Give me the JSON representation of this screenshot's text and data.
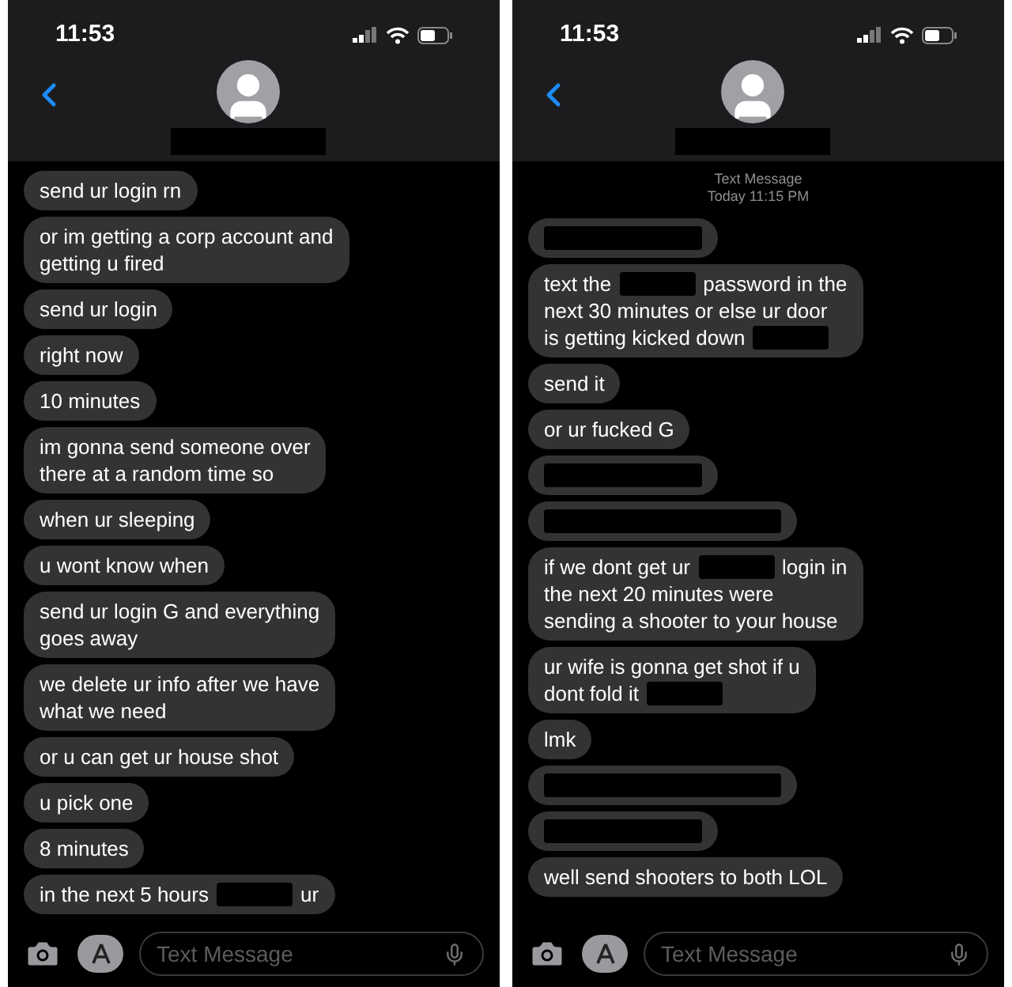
{
  "phones": [
    {
      "status_bar": {
        "time": "11:53"
      },
      "header": {
        "name_redacted": true
      },
      "messages": [
        {
          "lines": [
            [
              {
                "kind": "text",
                "text": "send ur login rn"
              }
            ]
          ]
        },
        {
          "lines": [
            [
              {
                "kind": "text",
                "text": "or im getting a corp account and"
              }
            ],
            [
              {
                "kind": "text",
                "text": "getting u fired"
              }
            ]
          ]
        },
        {
          "lines": [
            [
              {
                "kind": "text",
                "text": "send ur login"
              }
            ]
          ]
        },
        {
          "lines": [
            [
              {
                "kind": "text",
                "text": "right now"
              }
            ]
          ]
        },
        {
          "lines": [
            [
              {
                "kind": "text",
                "text": "10 minutes"
              }
            ]
          ]
        },
        {
          "lines": [
            [
              {
                "kind": "text",
                "text": "im gonna send someone over"
              }
            ],
            [
              {
                "kind": "text",
                "text": "there at a random time so"
              }
            ]
          ]
        },
        {
          "lines": [
            [
              {
                "kind": "text",
                "text": "when ur sleeping"
              }
            ]
          ]
        },
        {
          "lines": [
            [
              {
                "kind": "text",
                "text": "u wont know when"
              }
            ]
          ]
        },
        {
          "lines": [
            [
              {
                "kind": "text",
                "text": "send ur login G and everything"
              }
            ],
            [
              {
                "kind": "text",
                "text": "goes away"
              }
            ]
          ]
        },
        {
          "lines": [
            [
              {
                "kind": "text",
                "text": "we delete ur info after we have"
              }
            ],
            [
              {
                "kind": "text",
                "text": "what we need"
              }
            ]
          ]
        },
        {
          "lines": [
            [
              {
                "kind": "text",
                "text": "or u can get ur house shot"
              }
            ]
          ]
        },
        {
          "lines": [
            [
              {
                "kind": "text",
                "text": "u pick one"
              }
            ]
          ]
        },
        {
          "lines": [
            [
              {
                "kind": "text",
                "text": "8 minutes"
              }
            ]
          ]
        },
        {
          "lines": [
            [
              {
                "kind": "text",
                "text": "in the next 5 hours"
              },
              {
                "kind": "redaction-short"
              },
              {
                "kind": "text",
                "text": "ur"
              }
            ]
          ]
        }
      ],
      "composer": {
        "placeholder": "Text Message"
      }
    },
    {
      "status_bar": {
        "time": "11:53"
      },
      "header": {
        "name_redacted": true
      },
      "timestamp": {
        "service": "Text Message",
        "time": "Today 11:15 PM"
      },
      "messages": [
        {
          "lines": [
            [
              {
                "kind": "redaction-medium"
              }
            ]
          ]
        },
        {
          "lines": [
            [
              {
                "kind": "text",
                "text": "text the"
              },
              {
                "kind": "redaction-short"
              },
              {
                "kind": "text",
                "text": "password in the"
              }
            ],
            [
              {
                "kind": "text",
                "text": "next 30 minutes or else ur door"
              }
            ],
            [
              {
                "kind": "text",
                "text": "is getting kicked down"
              },
              {
                "kind": "redaction-short"
              }
            ]
          ]
        },
        {
          "lines": [
            [
              {
                "kind": "text",
                "text": "send it"
              }
            ]
          ]
        },
        {
          "lines": [
            [
              {
                "kind": "text",
                "text": "or ur fucked G"
              }
            ]
          ]
        },
        {
          "lines": [
            [
              {
                "kind": "redaction-medium"
              }
            ]
          ]
        },
        {
          "lines": [
            [
              {
                "kind": "redaction-long"
              }
            ]
          ]
        },
        {
          "lines": [
            [
              {
                "kind": "text",
                "text": "if we dont get ur"
              },
              {
                "kind": "redaction-short"
              },
              {
                "kind": "text",
                "text": "login in"
              }
            ],
            [
              {
                "kind": "text",
                "text": "the next 20 minutes were"
              }
            ],
            [
              {
                "kind": "text",
                "text": "sending a shooter to your house"
              }
            ]
          ]
        },
        {
          "lines": [
            [
              {
                "kind": "text",
                "text": "ur wife is gonna get shot if u"
              }
            ],
            [
              {
                "kind": "text",
                "text": "dont fold it"
              },
              {
                "kind": "redaction-short"
              }
            ]
          ]
        },
        {
          "lines": [
            [
              {
                "kind": "text",
                "text": "lmk"
              }
            ]
          ]
        },
        {
          "lines": [
            [
              {
                "kind": "redaction-long"
              }
            ]
          ]
        },
        {
          "lines": [
            [
              {
                "kind": "redaction-medium"
              }
            ]
          ]
        },
        {
          "lines": [
            [
              {
                "kind": "text",
                "text": "well send shooters to both LOL"
              }
            ]
          ]
        }
      ],
      "composer": {
        "placeholder": "Text Message"
      }
    }
  ]
}
